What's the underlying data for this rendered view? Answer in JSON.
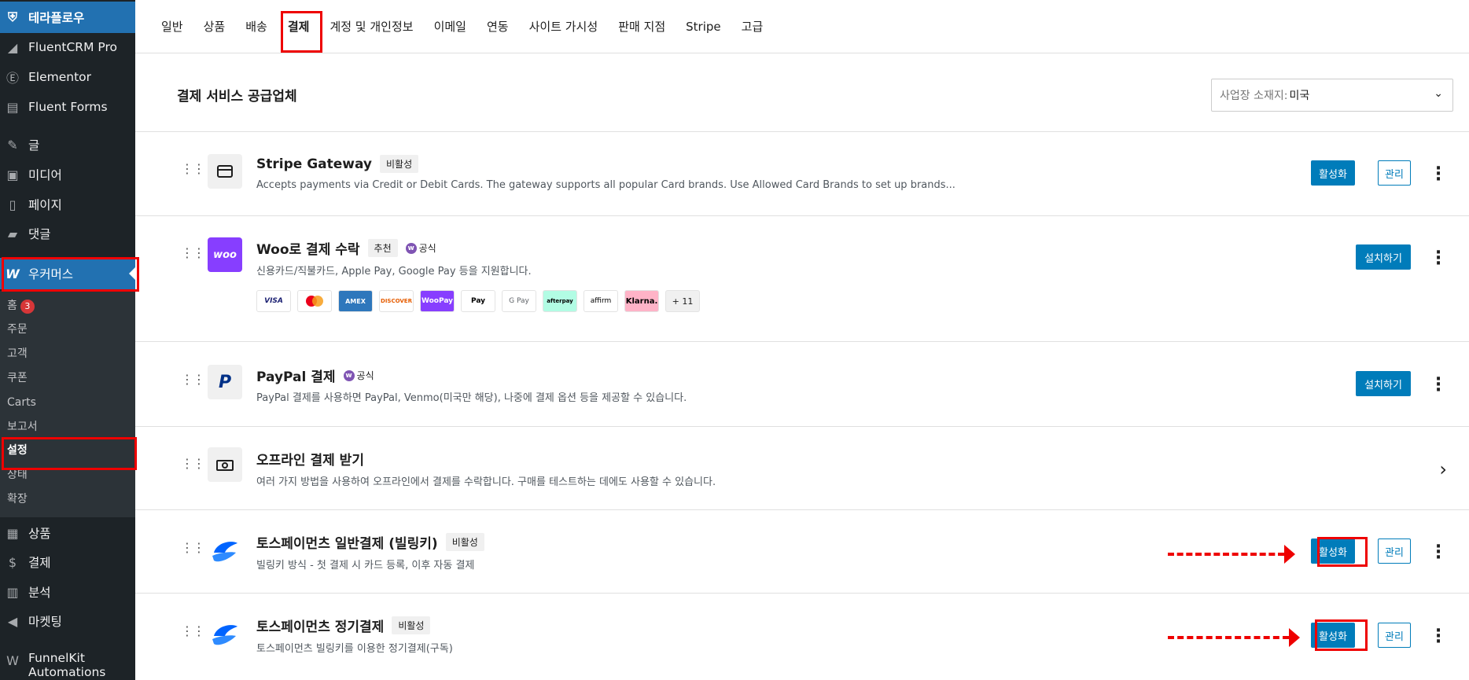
{
  "sidebar": {
    "brand": "테라플로우",
    "items": [
      {
        "label": "FluentCRM Pro",
        "icon": "fluentcrm-icon"
      },
      {
        "label": "Elementor",
        "icon": "elementor-icon"
      },
      {
        "label": "Fluent Forms",
        "icon": "fluent-forms-icon"
      },
      {
        "label": "글",
        "icon": "pin-icon"
      },
      {
        "label": "미디어",
        "icon": "media-icon"
      },
      {
        "label": "페이지",
        "icon": "page-icon"
      },
      {
        "label": "댓글",
        "icon": "comment-icon"
      },
      {
        "label": "우커머스",
        "icon": "woo-icon"
      },
      {
        "label": "상품",
        "icon": "archive-icon"
      },
      {
        "label": "결제",
        "icon": "dollar-icon"
      },
      {
        "label": "분석",
        "icon": "chart-icon"
      },
      {
        "label": "마켓팅",
        "icon": "megaphone-icon"
      },
      {
        "label": "FunnelKit Automations",
        "icon": "funnelkit-icon"
      }
    ],
    "submenu": [
      {
        "label": "홈",
        "badge": "3"
      },
      {
        "label": "주문"
      },
      {
        "label": "고객"
      },
      {
        "label": "쿠폰"
      },
      {
        "label": "Carts"
      },
      {
        "label": "보고서"
      },
      {
        "label": "설정"
      },
      {
        "label": "상태"
      },
      {
        "label": "확장"
      }
    ]
  },
  "tabs": [
    "일반",
    "상품",
    "배송",
    "결제",
    "계정 및 개인정보",
    "이메일",
    "연동",
    "사이트 가시성",
    "판매 지점",
    "Stripe",
    "고급"
  ],
  "active_tab": "결제",
  "panel": {
    "title": "결제 서비스 공급업체",
    "country_label": "사업장 소재지:",
    "country_value": "미국"
  },
  "providers": [
    {
      "name": "Stripe Gateway",
      "pill": "비활성",
      "desc": "Accepts payments via Credit or Debit Cards. The gateway supports all popular Card brands. Use Allowed Card Brands to set up brands...",
      "primary": "활성화",
      "secondary": "관리",
      "logo": "card-icon"
    },
    {
      "name": "Woo로 결제 수락",
      "pill": "추천",
      "official": "공식",
      "desc": "신용카드/직불카드, Apple Pay, Google Pay 등을 지원합니다.",
      "primary": "설치하기",
      "logo": "woo-logo",
      "cards": [
        "VISA",
        "MC",
        "AMEX",
        "DISCOVER",
        "WooPay",
        "Pay",
        "G Pay",
        "afterpay",
        "affirm",
        "Klarna.",
        "+ 11"
      ]
    },
    {
      "name": "PayPal 결제",
      "official": "공식",
      "desc": "PayPal 결제를 사용하면 PayPal, Venmo(미국만 해당), 나중에 결제 옵션 등을 제공할 수 있습니다.",
      "primary": "설치하기",
      "logo": "paypal-logo"
    },
    {
      "name": "오프라인 결제 받기",
      "desc": "여러 가지 방법을 사용하여 오프라인에서 결제를 수락합니다. 구매를 테스트하는 데에도 사용할 수 있습니다.",
      "logo": "cash-icon"
    },
    {
      "name": "토스페이먼츠 일반결제 (빌링키)",
      "pill": "비활성",
      "desc": "빌링키 방식 - 첫 결제 시 카드 등록, 이후 자동 결제",
      "primary": "활성화",
      "secondary": "관리",
      "logo": "toss-logo"
    },
    {
      "name": "토스페이먼츠 정기결제",
      "pill": "비활성",
      "desc": "토스페이먼츠 빌링키를 이용한 정기결제(구독)",
      "primary": "활성화",
      "secondary": "관리",
      "logo": "toss-logo"
    }
  ],
  "colors": {
    "accent": "#007cba",
    "sidebar": "#1d2327",
    "highlight": "#e00000"
  }
}
